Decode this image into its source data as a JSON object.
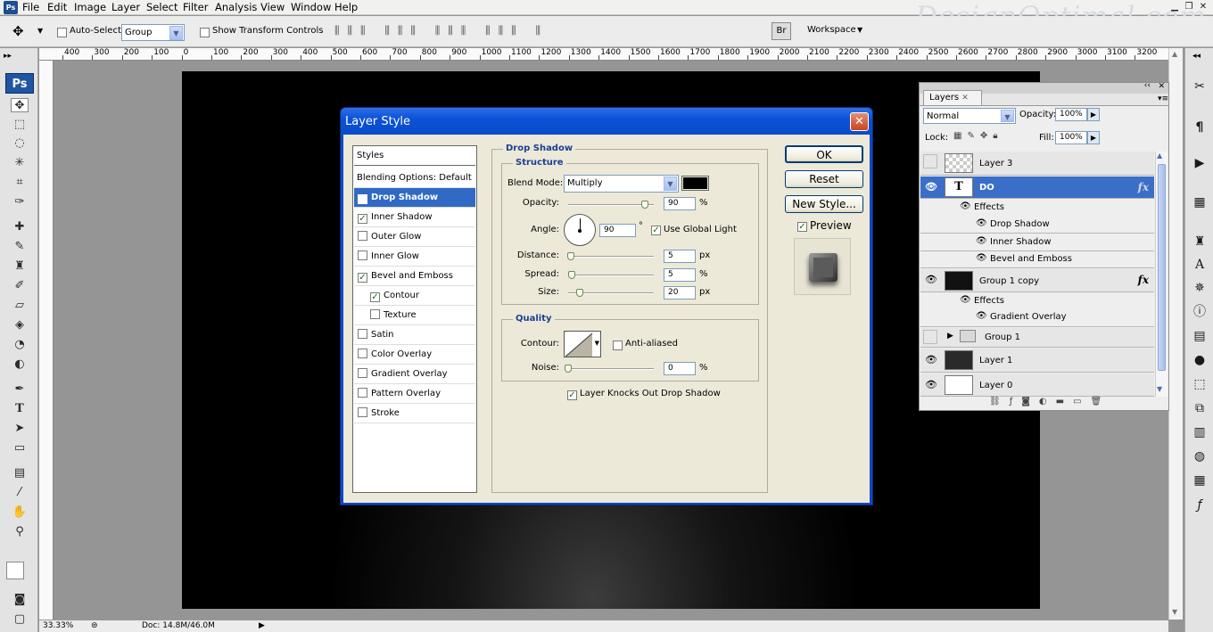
{
  "menubar": {
    "items": [
      "File",
      "Edit",
      "Image",
      "Layer",
      "Select",
      "Filter",
      "Analysis",
      "View",
      "Window",
      "Help"
    ],
    "app_icon": "Ps"
  },
  "watermark": "DesignOptimal.com",
  "options_bar": {
    "auto_select_label": "Auto-Select:",
    "auto_select_value": "Group",
    "show_transform_label": "Show Transform Controls",
    "workspace_label": "Workspace"
  },
  "toolbox": {
    "logo": "Ps"
  },
  "ruler": {
    "labels": [
      "400",
      "300",
      "200",
      "100",
      "0",
      "100",
      "200",
      "300",
      "400",
      "500",
      "600",
      "700",
      "800",
      "900",
      "1000",
      "1100",
      "1200",
      "1300",
      "1400",
      "1500",
      "1600",
      "1700",
      "1800",
      "1900",
      "2000",
      "2100",
      "2200",
      "2300",
      "2400",
      "2500",
      "2600",
      "2700",
      "2800",
      "2900",
      "3000",
      "3100",
      "3200"
    ]
  },
  "status": {
    "zoom": "33.33%",
    "doc": "Doc: 14.8M/46.0M"
  },
  "dialog": {
    "title": "Layer Style",
    "close_label": "✕",
    "styles_header": "Styles",
    "blending_options": "Blending Options: Default",
    "style_items": [
      {
        "label": "Drop Shadow",
        "checked": true,
        "selected": true
      },
      {
        "label": "Inner Shadow",
        "checked": true
      },
      {
        "label": "Outer Glow",
        "checked": false
      },
      {
        "label": "Inner Glow",
        "checked": false
      },
      {
        "label": "Bevel and Emboss",
        "checked": true
      },
      {
        "label": "Contour",
        "checked": true,
        "indent": true
      },
      {
        "label": "Texture",
        "checked": false,
        "indent": true
      },
      {
        "label": "Satin",
        "checked": false
      },
      {
        "label": "Color Overlay",
        "checked": false
      },
      {
        "label": "Gradient Overlay",
        "checked": false
      },
      {
        "label": "Pattern Overlay",
        "checked": false
      },
      {
        "label": "Stroke",
        "checked": false
      }
    ],
    "panel_title": "Drop Shadow",
    "structure": {
      "title": "Structure",
      "blend_mode_label": "Blend Mode:",
      "blend_mode_value": "Multiply",
      "shadow_color": "#000000",
      "opacity_label": "Opacity:",
      "opacity_value": "90",
      "opacity_fraction": 0.9,
      "pct": "%",
      "angle_label": "Angle:",
      "angle_value": "90",
      "degree": "°",
      "use_global_light": "Use Global Light",
      "distance_label": "Distance:",
      "distance_value": "5",
      "spread_label": "Spread:",
      "spread_value": "5",
      "size_label": "Size:",
      "size_value": "20",
      "px": "px"
    },
    "quality": {
      "title": "Quality",
      "contour_label": "Contour:",
      "anti_aliased": "Anti-aliased",
      "noise_label": "Noise:",
      "noise_value": "0"
    },
    "knockout_label": "Layer Knocks Out Drop Shadow",
    "buttons": {
      "ok": "OK",
      "reset": "Reset",
      "new_style": "New Style..."
    },
    "preview_label": "Preview"
  },
  "layers_panel": {
    "tab": "Layers",
    "blend_mode": "Normal",
    "opacity_label": "Opacity:",
    "opacity_value": "100%",
    "lock_label": "Lock:",
    "fill_label": "Fill:",
    "fill_value": "100%",
    "rows": {
      "layer3": "Layer 3",
      "do_layer": "DO",
      "do_thumb": "T",
      "effects": "Effects",
      "drop_shadow": "Drop Shadow",
      "inner_shadow": "Inner Shadow",
      "bevel": "Bevel and Emboss",
      "group1copy": "Group 1 copy",
      "effects2": "Effects",
      "gradient_overlay": "Gradient Overlay",
      "group1": "Group 1",
      "layer1": "Layer 1",
      "layer0": "Layer 0"
    },
    "fx": "fx"
  },
  "colors": {
    "accent": "#316ac5",
    "dialog_title": "#0b52d6",
    "canvas": "#000000"
  }
}
